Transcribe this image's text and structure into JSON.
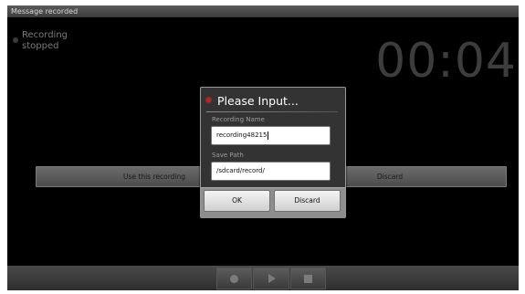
{
  "statusbar": {
    "title": "Message recorded"
  },
  "recorder": {
    "status": "Recording\nstopped",
    "timer": "00:04"
  },
  "action_bar": {
    "use_label": "Use this recording",
    "discard_label": "Discard"
  },
  "dialog": {
    "title": "Please Input...",
    "recording_name_label": "Recording Name",
    "recording_name_value": "recording48215",
    "save_path_label": "Save Path",
    "save_path_value": "/sdcard/record/",
    "ok_label": "OK",
    "discard_label": "Discard"
  },
  "controls": {
    "icons": [
      "record-icon",
      "play-icon",
      "stop-icon"
    ]
  },
  "colors": {
    "background": "#000000",
    "accent_red": "#d41a1a",
    "timer": "#3d3d3d"
  }
}
